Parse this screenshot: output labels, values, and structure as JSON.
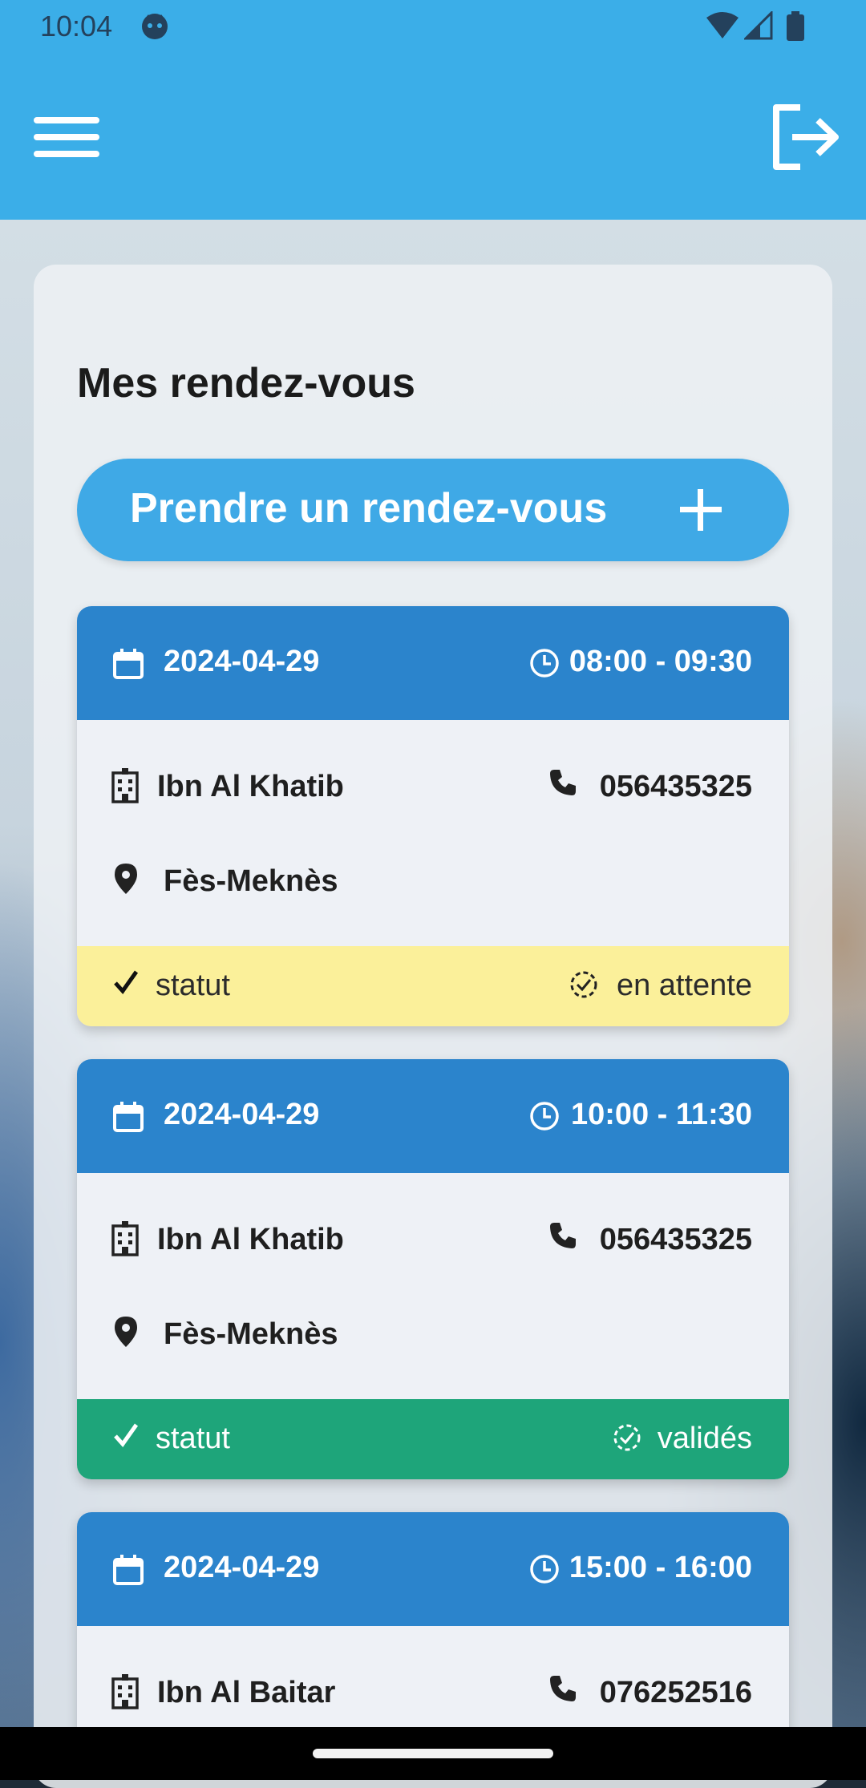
{
  "status_bar": {
    "time": "10:04",
    "icons": [
      "face-icon",
      "wifi-icon",
      "signal-icon",
      "battery-icon"
    ]
  },
  "app_bar": {
    "menu_icon": "menu-icon",
    "logout_icon": "logout-icon",
    "color": "#3baee8"
  },
  "main": {
    "title": "Mes rendez-vous",
    "book_button": {
      "label": "Prendre un rendez-vous",
      "icon": "plus-icon"
    },
    "appointments": [
      {
        "date": "2024-04-29",
        "time": "08:00 - 09:30",
        "hospital": "Ibn Al Khatib",
        "phone": "056435325",
        "region": "Fès-Meknès",
        "status_label": "statut",
        "status_value": "en attente",
        "status_color": "#fbf09a"
      },
      {
        "date": "2024-04-29",
        "time": "10:00 - 11:30",
        "hospital": "Ibn Al Khatib",
        "phone": "056435325",
        "region": "Fès-Meknès",
        "status_label": "statut",
        "status_value": "validés",
        "status_color": "#1ea57a"
      },
      {
        "date": "2024-04-29",
        "time": "15:00 - 16:00",
        "hospital": "Ibn Al Baitar",
        "phone": "076252516"
      }
    ]
  },
  "colors": {
    "card_header": "#2b84cc",
    "button": "#3fa9e6"
  }
}
